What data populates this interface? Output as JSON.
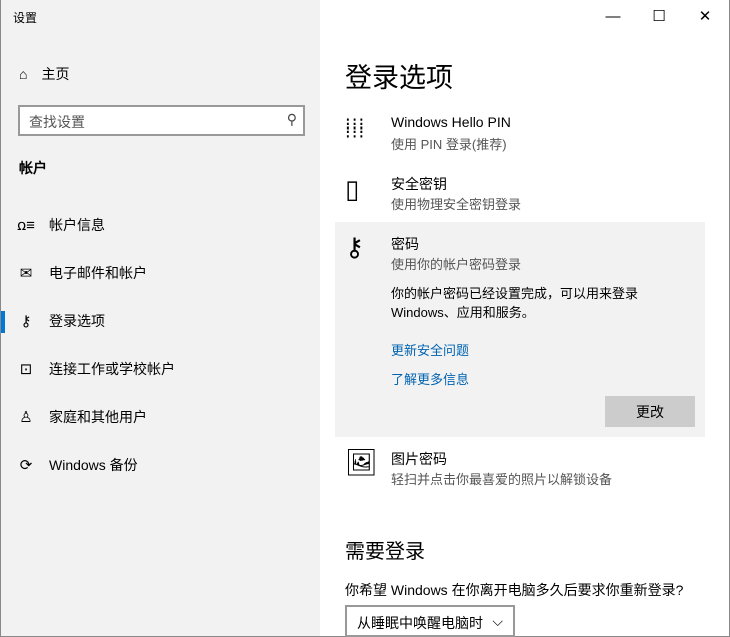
{
  "window": {
    "title": "设置",
    "minimize": "—",
    "maximize": "☐",
    "close": "✕"
  },
  "sidebar": {
    "home": "主页",
    "search_placeholder": "查找设置",
    "section": "帐户",
    "items": [
      {
        "label": "帐户信息",
        "icon": "person-list-icon"
      },
      {
        "label": "电子邮件和帐户",
        "icon": "mail-icon"
      },
      {
        "label": "登录选项",
        "icon": "key-icon"
      },
      {
        "label": "连接工作或学校帐户",
        "icon": "briefcase-icon"
      },
      {
        "label": "家庭和其他用户",
        "icon": "person-add-icon"
      },
      {
        "label": "Windows 备份",
        "icon": "sync-icon"
      }
    ]
  },
  "main": {
    "title": "登录选项",
    "options": [
      {
        "title": "Windows Hello PIN",
        "subtitle": "使用 PIN 登录(推荐)"
      },
      {
        "title": "安全密钥",
        "subtitle": "使用物理安全密钥登录"
      },
      {
        "title": "密码",
        "subtitle": "使用你的帐户密码登录"
      },
      {
        "title": "图片密码",
        "subtitle": "轻扫并点击你最喜爱的照片以解锁设备"
      }
    ],
    "password_desc": "你的帐户密码已经设置完成，可以用来登录 Windows、应用和服务。",
    "link_security": "更新安全问题",
    "link_more": "了解更多信息",
    "change_button": "更改",
    "require_heading": "需要登录",
    "require_question": "你希望 Windows 在你离开电脑多久后要求你重新登录?",
    "require_value": "从睡眠中唤醒电脑时"
  },
  "accent": "#0078d7"
}
